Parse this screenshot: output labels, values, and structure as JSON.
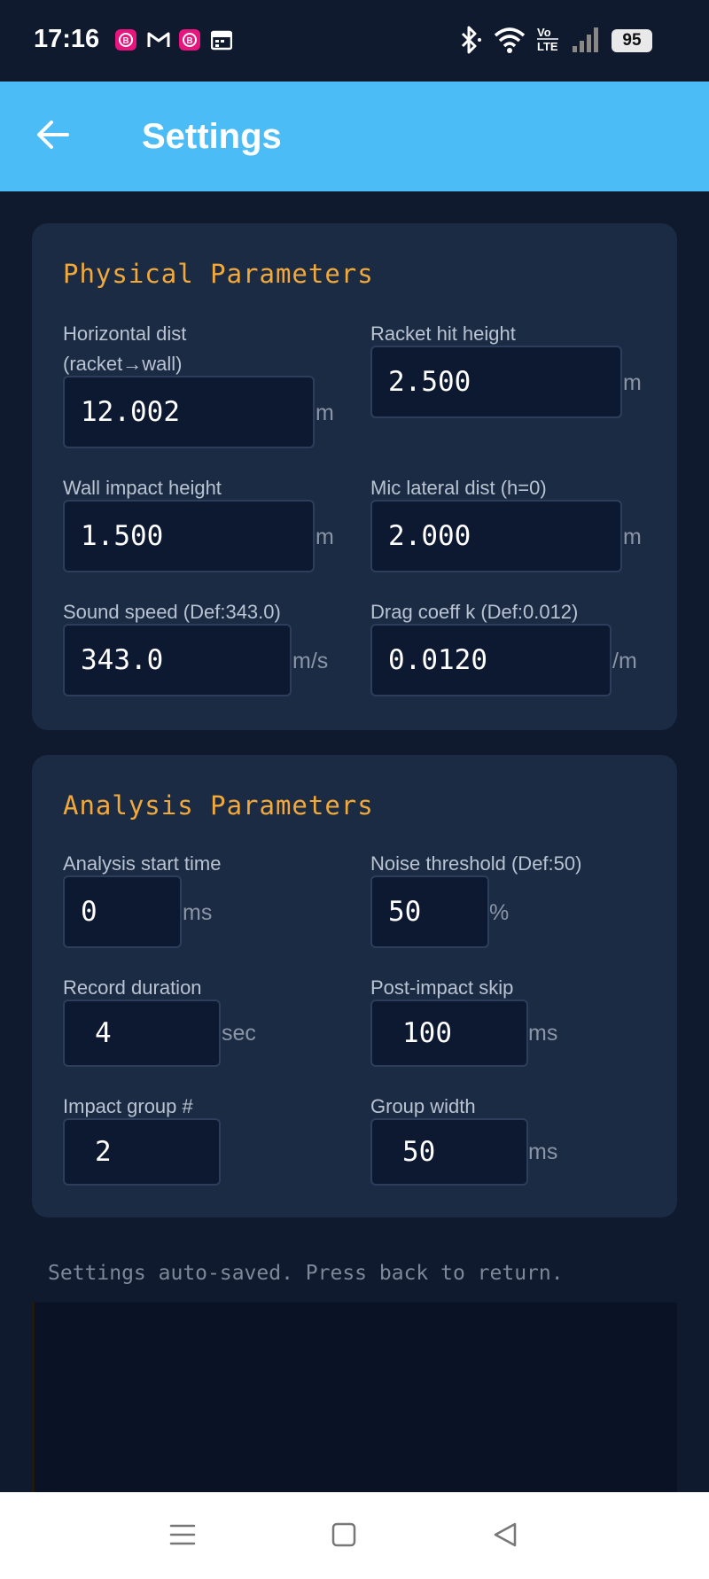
{
  "status_bar": {
    "time": "17:16",
    "battery": "95",
    "notification_icons": [
      "app-notification-icon",
      "gmail-icon",
      "app-notification-icon",
      "calendar-icon"
    ],
    "system_icons": [
      "bluetooth-icon",
      "wifi-icon",
      "volte-icon",
      "signal-icon",
      "battery-icon"
    ]
  },
  "app_bar": {
    "title": "Settings"
  },
  "physical": {
    "title": "Physical Parameters",
    "horizontal_dist": {
      "label": "Horizontal dist\n(racket→wall)",
      "value": "12.002",
      "unit": "m"
    },
    "racket_hit_height": {
      "label": "Racket hit height",
      "value": "2.500",
      "unit": "m"
    },
    "wall_impact_height": {
      "label": "Wall impact height",
      "value": "1.500",
      "unit": "m"
    },
    "mic_lateral_dist": {
      "label": "Mic lateral dist (h=0)",
      "value": "2.000",
      "unit": "m"
    },
    "sound_speed": {
      "label": "Sound speed (Def:343.0)",
      "value": "343.0",
      "unit": "m/s"
    },
    "drag_coeff": {
      "label": "Drag coeff k (Def:0.012)",
      "value": "0.0120",
      "unit": "/m"
    }
  },
  "analysis": {
    "title": "Analysis Parameters",
    "start_time": {
      "label": "Analysis start time",
      "value": "0",
      "unit": "ms"
    },
    "noise_threshold": {
      "label": "Noise threshold (Def:50)",
      "value": "50",
      "unit": "%"
    },
    "record_duration": {
      "label": "Record duration",
      "value": "4",
      "unit": "sec"
    },
    "post_impact_skip": {
      "label": "Post-impact skip",
      "value": "100",
      "unit": "ms"
    },
    "impact_group": {
      "label": "Impact group #",
      "value": "2",
      "unit": ""
    },
    "group_width": {
      "label": "Group width",
      "value": "50",
      "unit": "ms"
    }
  },
  "footer_note": "Settings auto-saved. Press back to return.",
  "colors": {
    "app_bar": "#4bbcf6",
    "background": "#0f1a2e",
    "card": "#1b2b44",
    "section_title": "#f2a93b",
    "input_bg": "#0d1831"
  }
}
